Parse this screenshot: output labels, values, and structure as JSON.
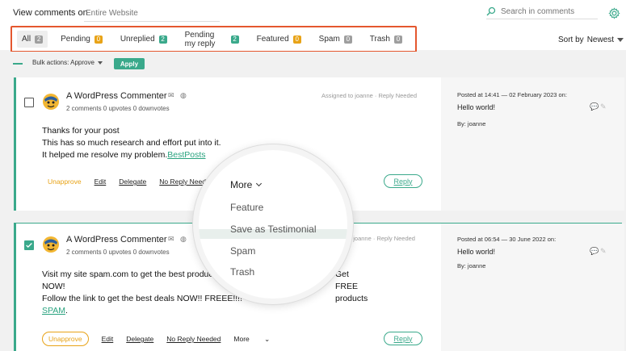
{
  "topbar": {
    "view_label": "View comments on",
    "view_placeholder": "Entire Website",
    "search_placeholder": "Search in comments"
  },
  "tabs": [
    {
      "label": "All",
      "count": "2",
      "color": "#9e9e9e",
      "active": true
    },
    {
      "label": "Pending",
      "count": "0",
      "color": "#e8a317"
    },
    {
      "label": "Unreplied",
      "count": "2",
      "color": "#3aa98b"
    },
    {
      "label": "Pending my reply",
      "count": "2",
      "color": "#3aa98b"
    },
    {
      "label": "Featured",
      "count": "0",
      "color": "#e8a317"
    },
    {
      "label": "Spam",
      "count": "0",
      "color": "#9e9e9e"
    },
    {
      "label": "Trash",
      "count": "0",
      "color": "#9e9e9e"
    }
  ],
  "sort": {
    "label": "Sort by",
    "value": "Newest"
  },
  "bulk": {
    "label": "Bulk actions:",
    "value": "Approve",
    "apply": "Apply"
  },
  "comments": [
    {
      "author": "A WordPress Commenter",
      "stats": "2 comments   0 upvotes   0 downvotes",
      "assigned": "Assigned to joanne · Reply Needed",
      "lines": [
        "Thanks for your post",
        "This has so much research and effort put into it."
      ],
      "line3_text": "It helped me resolve my problem.",
      "line3_link": "BestPosts",
      "actions": {
        "unapprove": "Unapprove",
        "edit": "Edit",
        "delegate": "Delegate",
        "no_reply": "No Reply Needed"
      },
      "reply": "Reply",
      "side": {
        "date": "Posted at 14:41 — 02 February 2023 on:",
        "post": "Hello world!",
        "by": "By: joanne"
      }
    },
    {
      "author": "A WordPress Commenter",
      "stats": "2 comments   0 upvotes   0 downvotes",
      "assigned": "o joanne · Reply Needed",
      "line1a": "Visit my site spam.com to get the best produc",
      "line1b": "Get FREE products",
      "line2": "NOW!",
      "line3": "Follow the link to get the best deals NOW!! FREEE!!!!",
      "link": "SPAM",
      "link_suffix": ".",
      "actions": {
        "unapprove": "Unapprove",
        "edit": "Edit",
        "delegate": "Delegate",
        "no_reply": "No Reply Needed",
        "more": "More"
      },
      "reply": "Reply",
      "side": {
        "date": "Posted at 06:54 — 30 June 2022 on:",
        "post": "Hello world!",
        "by": "By: joanne"
      }
    }
  ],
  "magnifier": {
    "more": "More",
    "items": [
      "Feature",
      "Save as Testimonial",
      "Spam",
      "Trash"
    ]
  }
}
